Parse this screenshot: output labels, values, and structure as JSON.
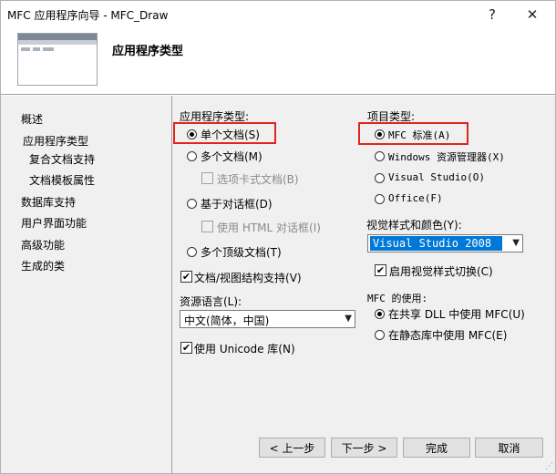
{
  "window": {
    "title": "MFC 应用程序向导 - MFC_Draw"
  },
  "titlebar_buttons": {
    "help": "?",
    "close": "✕"
  },
  "header": {
    "title": "应用程序类型"
  },
  "nav": [
    {
      "label": "概述"
    },
    {
      "label": "应用程序类型"
    },
    {
      "label": "复合文档支持"
    },
    {
      "label": "文档模板属性"
    },
    {
      "label": "数据库支持"
    },
    {
      "label": "用户界面功能"
    },
    {
      "label": "高级功能"
    },
    {
      "label": "生成的类"
    }
  ],
  "app_type": {
    "group_label": "应用程序类型:",
    "single_doc": "单个文档(S)",
    "multi_doc": "多个文档(M)",
    "tabbed_docs": "选项卡式文档(B)",
    "dialog_based": "基于对话框(D)",
    "use_html_dialog": "使用 HTML 对话框(I)",
    "multi_toplevel": "多个顶级文档(T)",
    "doc_view_support": "文档/视图结构支持(V)",
    "resource_language_label": "资源语言(L):",
    "resource_language_value": "中文(简体，中国)",
    "use_unicode": "使用 Unicode 库(N)"
  },
  "project_type": {
    "group_label": "项目类型:",
    "mfc_standard": "MFC 标准(A)",
    "windows_explorer": "Windows 资源管理器(X)",
    "visual_studio": "Visual Studio(O)",
    "office": "Office(F)",
    "visual_style_label": "视觉样式和颜色(Y):",
    "visual_style_value": "Visual Studio 2008",
    "enable_style_switch": "启用视觉样式切换(C)",
    "mfc_usage_label": "MFC 的使用:",
    "shared_dll": "在共享 DLL 中使用 MFC(U)",
    "static_lib": "在静态库中使用 MFC(E)"
  },
  "buttons": {
    "prev": "< 上一步",
    "next": "下一步 >",
    "finish": "完成",
    "cancel": "取消"
  }
}
